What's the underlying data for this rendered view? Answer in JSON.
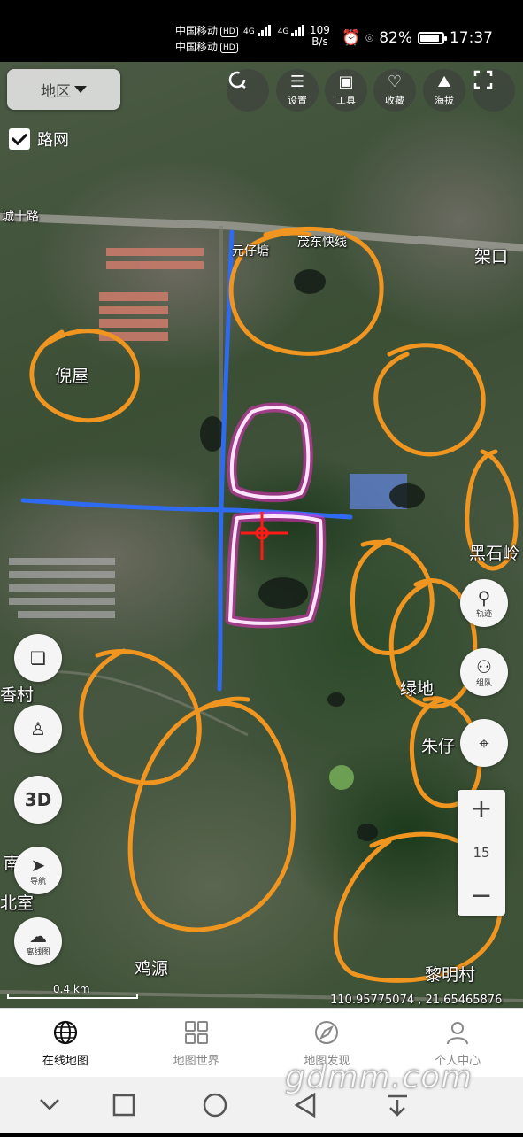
{
  "status_bar": {
    "carrier_1": "中国移动",
    "carrier_2": "中国移动",
    "hd": "HD",
    "network": "4G",
    "speed_value": "109",
    "speed_unit": "B/s",
    "battery": "82%",
    "battery_level": 0.82,
    "time": "17:37"
  },
  "top_bar": {
    "region_label": "地区",
    "roadnet_label": "路网",
    "roadnet_checked": true,
    "tools": [
      {
        "label": "",
        "icon": "refresh-icon"
      },
      {
        "label": "设置",
        "icon": "settings-icon"
      },
      {
        "label": "工具",
        "icon": "toolbox-icon"
      },
      {
        "label": "收藏",
        "icon": "heart-icon"
      },
      {
        "label": "海拔",
        "icon": "mountain-icon"
      },
      {
        "label": "",
        "icon": "fullscreen-icon"
      }
    ]
  },
  "map": {
    "place_labels": [
      "倪屋",
      "黑石岭",
      "绿地",
      "朱仔",
      "香村",
      "鸡源",
      "黎明村",
      "南",
      "北室",
      "架口"
    ],
    "road_labels": [
      "城十路",
      "茂东快线",
      "元仔塘"
    ],
    "annotation_colors": {
      "circles": "#f0951f",
      "lines": "#2f6bf0",
      "plots": "#ff2bd6",
      "marker": "#ff1a1a"
    }
  },
  "side_controls": {
    "track_label": "轨迹",
    "team_label": "组队",
    "three_d_label": "3D",
    "navigate_label": "导航",
    "offline_label": "离线图",
    "zoom_in": "+",
    "zoom_level": "15",
    "zoom_out": "−"
  },
  "scale": {
    "label": "0.4 km"
  },
  "coordinates": "110.95775074 , 21.65465876",
  "bottom_nav": [
    {
      "label": "在线地图",
      "icon": "globe-icon",
      "active": true
    },
    {
      "label": "地图世界",
      "icon": "grid-icon",
      "active": false
    },
    {
      "label": "地图发现",
      "icon": "compass-icon",
      "active": false
    },
    {
      "label": "个人中心",
      "icon": "person-icon",
      "active": false
    }
  ],
  "watermark": "gdmm.com"
}
